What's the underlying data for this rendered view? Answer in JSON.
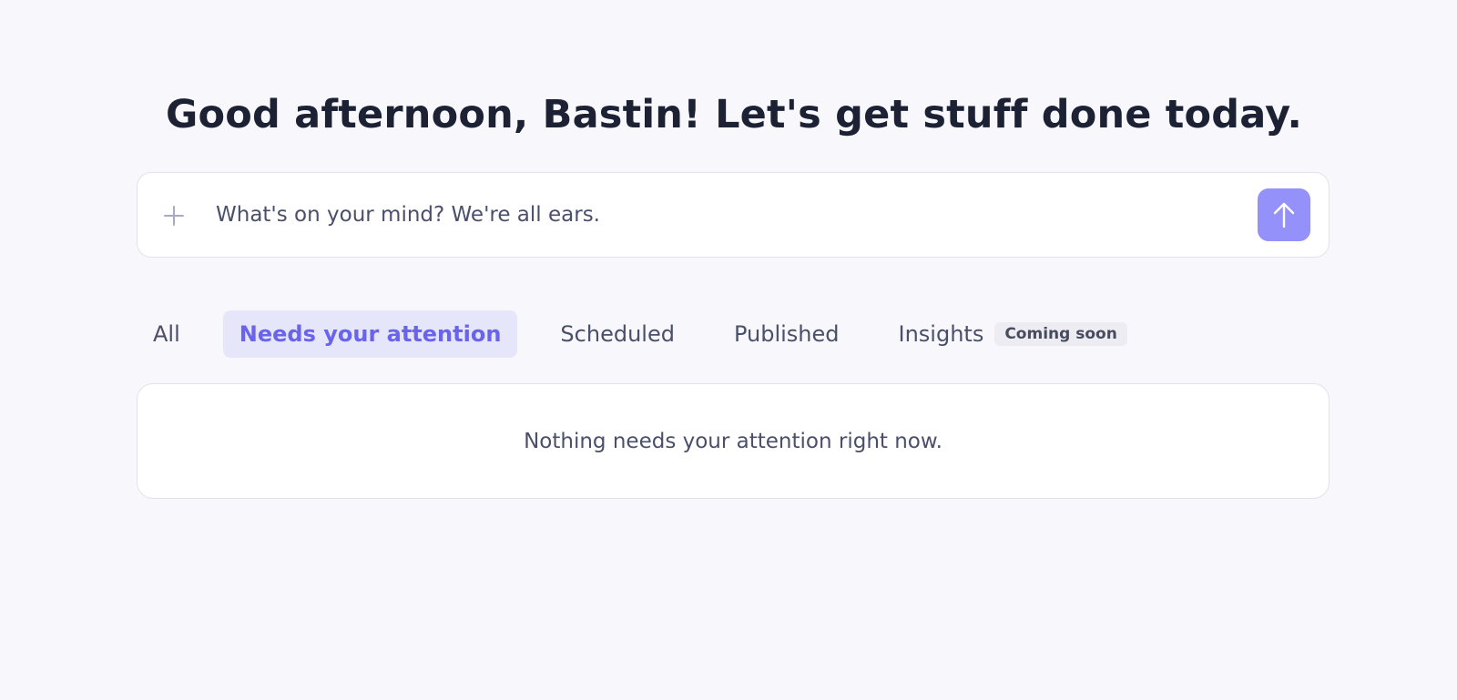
{
  "header": {
    "greeting": "Good afternoon, Bastin! Let's get stuff done today."
  },
  "composer": {
    "placeholder": "What's on your mind? We're all ears.",
    "value": "",
    "add_icon": "plus-icon",
    "send_icon": "arrow-up-icon"
  },
  "tabs": [
    {
      "label": "All",
      "active": false
    },
    {
      "label": "Needs your attention",
      "active": true
    },
    {
      "label": "Scheduled",
      "active": false
    },
    {
      "label": "Published",
      "active": false
    },
    {
      "label": "Insights",
      "active": false,
      "badge": "Coming soon"
    }
  ],
  "empty_state": {
    "message": "Nothing needs your attention right now."
  },
  "colors": {
    "background": "#f7f7fc",
    "accent": "#6a64ec",
    "send_button": "#9591fb",
    "active_tab_bg": "#e6e6fa",
    "heading": "#1c2234",
    "body_text": "#4a4f6a"
  }
}
